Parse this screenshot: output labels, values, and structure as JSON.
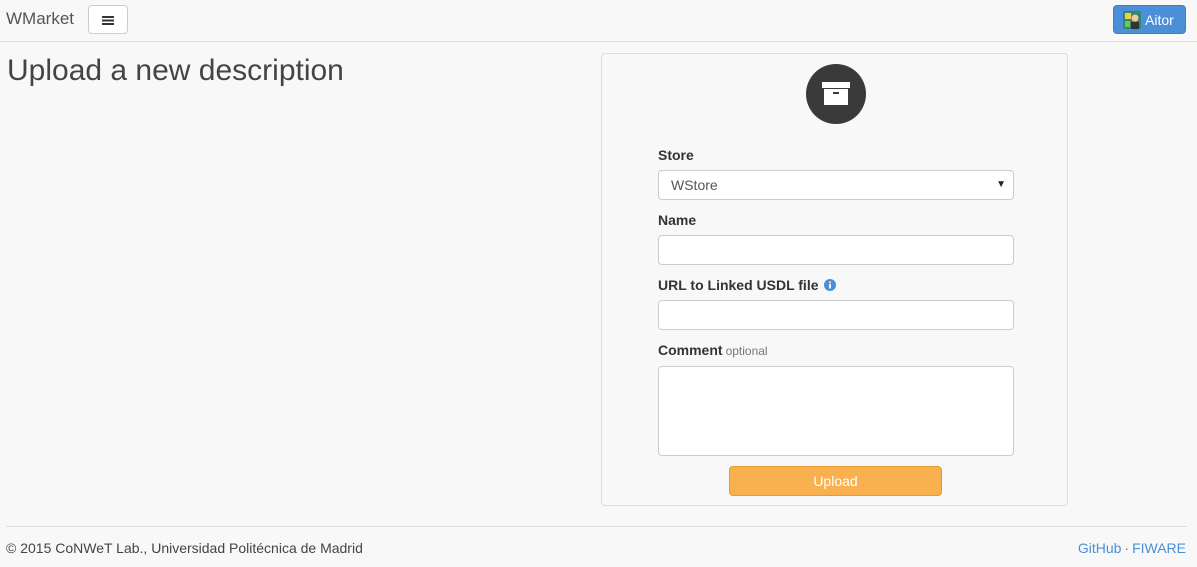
{
  "navbar": {
    "brand": "WMarket",
    "menu_icon": "hamburger-icon",
    "user": {
      "name": "Aitor",
      "avatar_icon": "user-avatar-icon"
    },
    "accent_color": "#4a8fd8"
  },
  "page": {
    "title": "Upload a new description"
  },
  "form": {
    "header_icon": "archive-box-icon",
    "store": {
      "label": "Store",
      "value": "WStore"
    },
    "name": {
      "label": "Name",
      "value": ""
    },
    "url": {
      "label": "URL to Linked USDL file",
      "value": "",
      "info_icon": "info-circle-icon"
    },
    "comment": {
      "label": "Comment",
      "optional_label": "optional",
      "value": ""
    },
    "submit_label": "Upload",
    "submit_color": "#f9b150"
  },
  "footer": {
    "copyright": "© 2015 CoNWeT Lab., Universidad Politécnica de Madrid",
    "links": [
      "GitHub",
      "FIWARE"
    ],
    "separator": "·"
  }
}
